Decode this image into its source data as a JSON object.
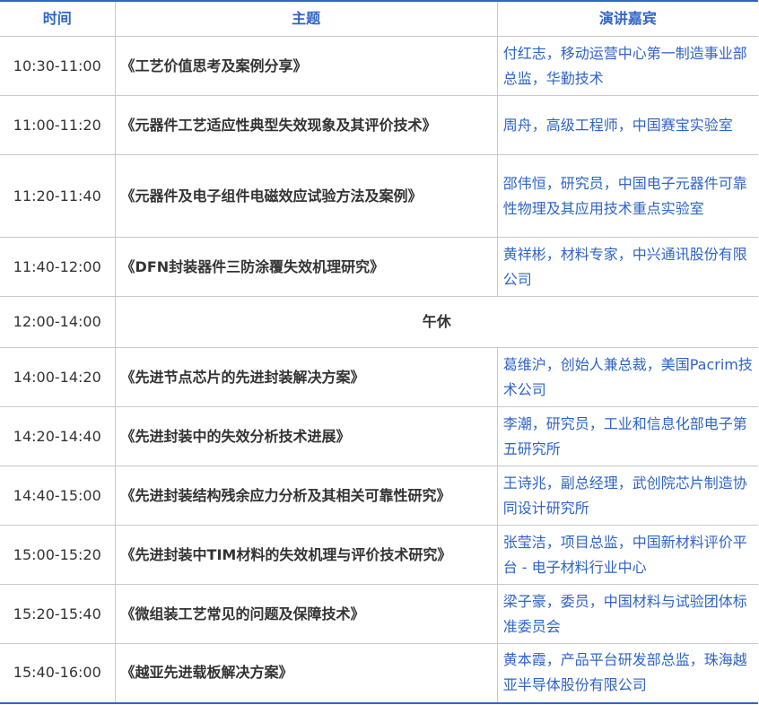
{
  "header": {
    "time": "时间",
    "topic": "主题",
    "speaker": "演讲嘉宾"
  },
  "rows": [
    {
      "time": "10:30-11:00",
      "topic": "《工艺价值思考及案例分享》",
      "speaker": "付红志，移动运营中心第一制造事业部总监，华勤技术"
    },
    {
      "time": "11:00-11:20",
      "topic": "《元器件工艺适应性典型失效现象及其评价技术》",
      "speaker": "周舟，高级工程师，中国赛宝实验室"
    },
    {
      "time": "11:20-11:40",
      "topic": "《元器件及电子组件电磁效应试验方法及案例》",
      "speaker": "邵伟恒，研究员，中国电子元器件可靠性物理及其应用技术重点实验室"
    },
    {
      "time": "11:40-12:00",
      "topic": "《DFN封装器件三防涂覆失效机理研究》",
      "speaker": "黄祥彬，材料专家，中兴通讯股份有限公司"
    },
    {
      "time": "12:00-14:00",
      "break": "午休"
    },
    {
      "time": "14:00-14:20",
      "topic": "《先进节点芯片的先进封装解决方案》",
      "speaker": "葛维沪，创始人兼总裁，美国Pacrim技术公司"
    },
    {
      "time": "14:20-14:40",
      "topic": "《先进封装中的失效分析技术进展》",
      "speaker": "李潮，研究员，工业和信息化部电子第五研究所"
    },
    {
      "time": "14:40-15:00",
      "topic": "《先进封装结构残余应力分析及其相关可靠性研究》",
      "speaker": "王诗兆，副总经理，武创院芯片制造协同设计研究所"
    },
    {
      "time": "15:00-15:20",
      "topic": "《先进封装中TIM材料的失效机理与评价技术研究》",
      "speaker": "张莹洁，项目总监，中国新材料评价平台 - 电子材料行业中心"
    },
    {
      "time": "15:20-15:40",
      "topic": "《微组装工艺常见的问题及保障技术》",
      "speaker": "梁子豪，委员，中国材料与试验团体标准委员会"
    },
    {
      "time": "15:40-16:00",
      "topic": "《越亚先进载板解决方案》",
      "speaker": "黄本霞，产品平台研发部总监，珠海越亚半导体股份有限公司"
    }
  ],
  "colors": {
    "accent": "#2f64c8",
    "text": "#333333",
    "grid": "#c9c9c9"
  }
}
